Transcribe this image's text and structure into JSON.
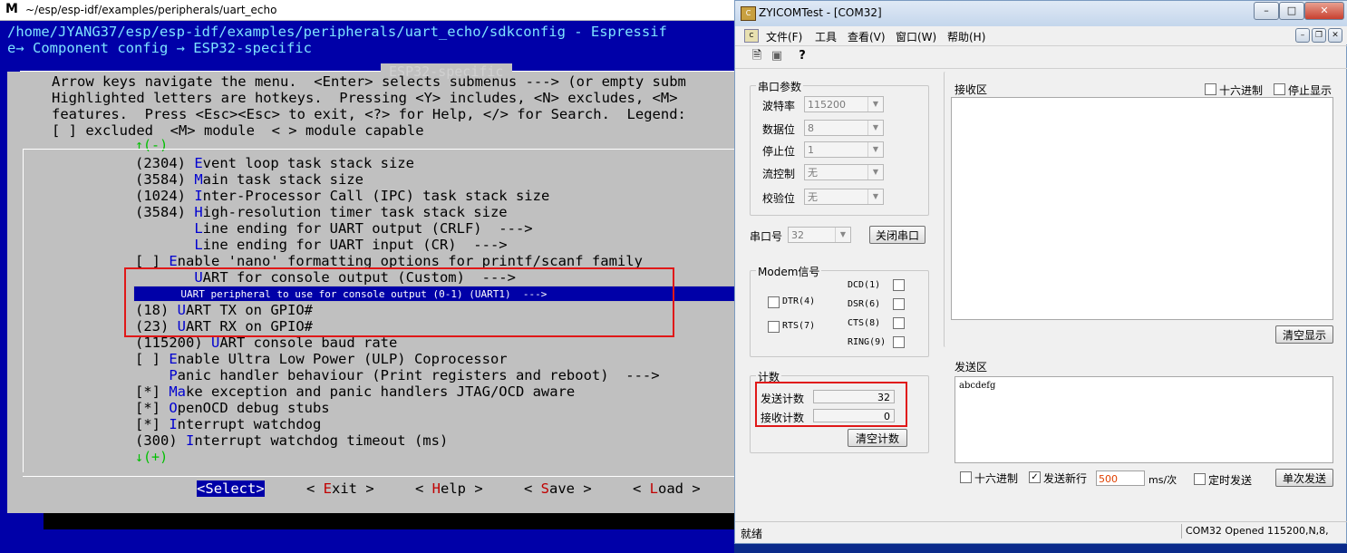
{
  "terminal": {
    "title": "~/esp/esp-idf/examples/peripherals/uart_echo",
    "path_line": "/home/JYANG37/esp/esp-idf/examples/peripherals/uart_echo/sdkconfig - Espressif",
    "breadcrumb": "e→ Component config → ESP32-specific",
    "dialog_title": " ESP32-specific ",
    "help_lines": [
      "Arrow keys navigate the menu.  <Enter> selects submenus ---> (or empty subm",
      "Highlighted letters are hotkeys.  Pressing <Y> includes, <N> excludes, <M>",
      "features.  Press <Esc><Esc> to exit, <?> for Help, </> for Search.  Legend:",
      "[ ] excluded  <M> module  < > module capable"
    ],
    "scroll_up": "↑(-)",
    "scroll_down": "↓(+)",
    "menu": [
      {
        "pre": "(2304) ",
        "hk": "E",
        "rest": "vent loop task stack size"
      },
      {
        "pre": "(3584) ",
        "hk": "M",
        "rest": "ain task stack size"
      },
      {
        "pre": "(1024) ",
        "hk": "I",
        "rest": "nter-Processor Call (IPC) task stack size"
      },
      {
        "pre": "(3584) ",
        "hk": "H",
        "rest": "igh-resolution timer task stack size"
      },
      {
        "pre": "       ",
        "hk": "L",
        "rest": "ine ending for UART output (CRLF)  --->"
      },
      {
        "pre": "       ",
        "hk": "L",
        "rest": "ine ending for UART input (CR)  --->"
      },
      {
        "pre": "[ ] ",
        "hk": "E",
        "rest": "nable 'nano' formatting options for printf/scanf family"
      },
      {
        "pre": "       ",
        "hk": "U",
        "rest": "ART for console output (Custom)  --->"
      },
      {
        "pre": "       ",
        "hk": "U",
        "rest": "ART peripheral to use for console output (0-1) (UART1)  --->"
      },
      {
        "pre": "(18) ",
        "hk": "U",
        "rest": "ART TX on GPIO#"
      },
      {
        "pre": "(23) ",
        "hk": "U",
        "rest": "ART RX on GPIO#"
      },
      {
        "pre": "(115200) ",
        "hk": "U",
        "rest": "ART console baud rate"
      },
      {
        "pre": "[ ] ",
        "hk": "E",
        "rest": "nable Ultra Low Power (ULP) Coprocessor"
      },
      {
        "pre": "    ",
        "hk": "P",
        "rest": "anic handler behaviour (Print registers and reboot)  --->"
      },
      {
        "pre": "[*] ",
        "hk": "Ma",
        "rest": "ke exception and panic handlers JTAG/OCD aware"
      },
      {
        "pre": "[*] ",
        "hk": "O",
        "rest": "penOCD debug stubs"
      },
      {
        "pre": "[*] ",
        "hk": "I",
        "rest": "nterrupt watchdog"
      },
      {
        "pre": "(300) ",
        "hk": "I",
        "rest": "nterrupt watchdog timeout (ms)"
      }
    ],
    "buttons": [
      {
        "pre": "<",
        "hk": "S",
        "rest": "elect>"
      },
      {
        "pre": "< ",
        "hk": "E",
        "rest": "xit >"
      },
      {
        "pre": "< ",
        "hk": "H",
        "rest": "elp >"
      },
      {
        "pre": "< ",
        "hk": "S",
        "rest": "ave >"
      },
      {
        "pre": "< ",
        "hk": "L",
        "rest": "oad >"
      }
    ]
  },
  "com": {
    "title": "ZYICOMTest - [COM32]",
    "menus": [
      "文件(F)",
      "工具",
      "查看(V)",
      "窗口(W)",
      "帮助(H)"
    ],
    "serial_params": {
      "group": "串口参数",
      "baud_label": "波特率",
      "baud": "115200",
      "data_label": "数据位",
      "data": "8",
      "stop_label": "停止位",
      "stop": "1",
      "flow_label": "流控制",
      "flow": "无",
      "parity_label": "校验位",
      "parity": "无"
    },
    "port_label": "串口号",
    "port": "32",
    "close_port": "关闭串口",
    "modem": {
      "group": "Modem信号",
      "dtr": "DTR(4)",
      "rts": "RTS(7)",
      "dcd": "DCD(1)",
      "dsr": "DSR(6)",
      "cts": "CTS(8)",
      "ring": "RING(9)"
    },
    "counter": {
      "group": "计数",
      "sent_label": "发送计数",
      "sent": "32",
      "recv_label": "接收计数",
      "recv": "0",
      "clear": "清空计数"
    },
    "receive": {
      "label": "接收区",
      "hex": "十六进制",
      "stop_display": "停止显示",
      "clear": "清空显示",
      "content": ""
    },
    "send": {
      "label": "发送区",
      "content": "abcdefg",
      "hex": "十六进制",
      "newline": "发送新行",
      "interval": "500",
      "unit": "ms/次",
      "timed": "定时发送",
      "single": "单次发送"
    },
    "status_left": "就绪",
    "status_right": "COM32  Opened  115200,N,8,"
  }
}
